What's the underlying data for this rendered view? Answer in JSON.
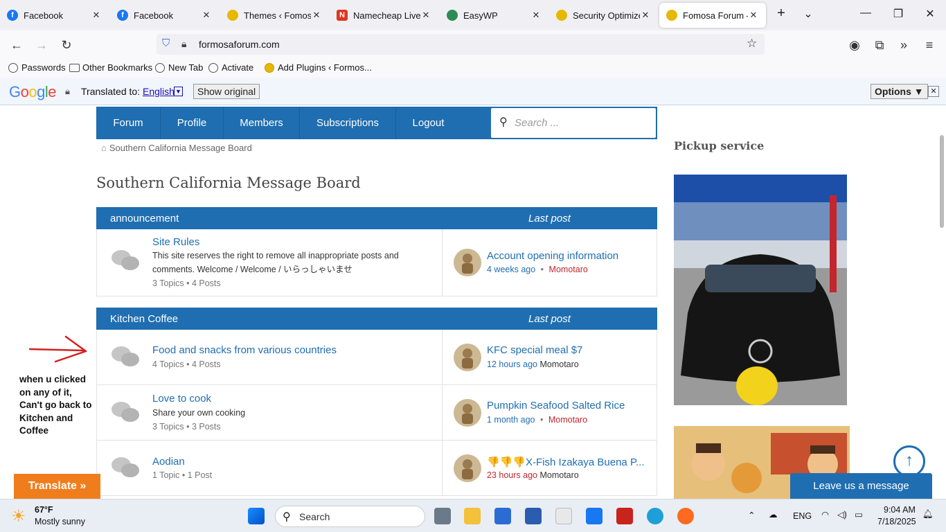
{
  "browser": {
    "tabs": [
      {
        "label": "Facebook",
        "icon": "facebook-icon",
        "color": "#1877f2"
      },
      {
        "label": "Facebook",
        "icon": "facebook-icon",
        "color": "#1877f2"
      },
      {
        "label": "Themes ‹ Fomosa F",
        "icon": "pineapple-icon",
        "color": "#e6b800"
      },
      {
        "label": "Namecheap LiveCh",
        "icon": "namecheap-icon",
        "color": "#de3723"
      },
      {
        "label": "EasyWP",
        "icon": "octopus-icon",
        "color": "#2e8b57"
      },
      {
        "label": "Security Optimizer",
        "icon": "pineapple-icon",
        "color": "#e6b800"
      },
      {
        "label": "Fomosa Forum – Lo",
        "icon": "pineapple-icon",
        "color": "#e6b800"
      }
    ],
    "url": "formosaforum.com",
    "bookmarks": [
      "Passwords",
      "Other Bookmarks",
      "New Tab",
      "Activate",
      "Add Plugins ‹ Formos..."
    ]
  },
  "translate_bar": {
    "logo": "Google",
    "translated_to": "Translated to:",
    "language": "English",
    "show_original": "Show original",
    "options": "Options ▼"
  },
  "forum_nav": {
    "items": [
      "Forum",
      "Profile",
      "Members",
      "Subscriptions",
      "Logout"
    ],
    "search_placeholder": "Search ..."
  },
  "breadcrumb": "Southern California Message Board",
  "board_title": "Southern California Message Board",
  "categories": [
    {
      "name": "announcement",
      "last_post_label": "Last post",
      "forums": [
        {
          "title": "Site Rules",
          "description": "This site reserves the right to remove all inappropriate posts and comments. Welcome / Welcome / いらっしゃいませ",
          "stats": "3 Topics • 4 Posts",
          "last_title": "Account opening information",
          "last_time": "4 weeks ago",
          "last_sep": "•",
          "last_author": "Momotaro"
        }
      ]
    },
    {
      "name": "Kitchen Coffee",
      "last_post_label": "Last post",
      "forums": [
        {
          "title": "Food and snacks from various countries",
          "description": "",
          "stats": "4 Topics • 4 Posts",
          "last_title": "KFC special meal $7",
          "last_time": "12 hours ago",
          "last_sep": "",
          "last_author": "Momotaro"
        },
        {
          "title": "Love to cook",
          "description": "Share your own cooking",
          "stats": "3 Topics • 3 Posts",
          "last_title": "Pumpkin Seafood Salted Rice",
          "last_time": "1 month ago",
          "last_sep": "•",
          "last_author": "Momotaro"
        },
        {
          "title": "Aodian",
          "description": "",
          "stats": "1 Topic • 1 Post",
          "last_title": "👎👎👎X-Fish Izakaya Buena P...",
          "last_time": "23 hours ago",
          "last_sep": "",
          "last_author": "Momotaro"
        }
      ]
    }
  ],
  "sidebar": {
    "heading": "Pickup service"
  },
  "annotation": "when u clicked on any of it, Can't go back to Kitchen and Coffee",
  "translate_button": "Translate »",
  "chat_button": "Leave us a message",
  "taskbar": {
    "weather_temp": "67°F",
    "weather_desc": "Mostly sunny",
    "search_label": "Search",
    "language": "ENG",
    "time": "9:04 AM",
    "date": "7/18/2025"
  },
  "colors": {
    "accent": "#1f6eb1",
    "red": "#c0262d",
    "translate_orange": "#f07d1c"
  }
}
